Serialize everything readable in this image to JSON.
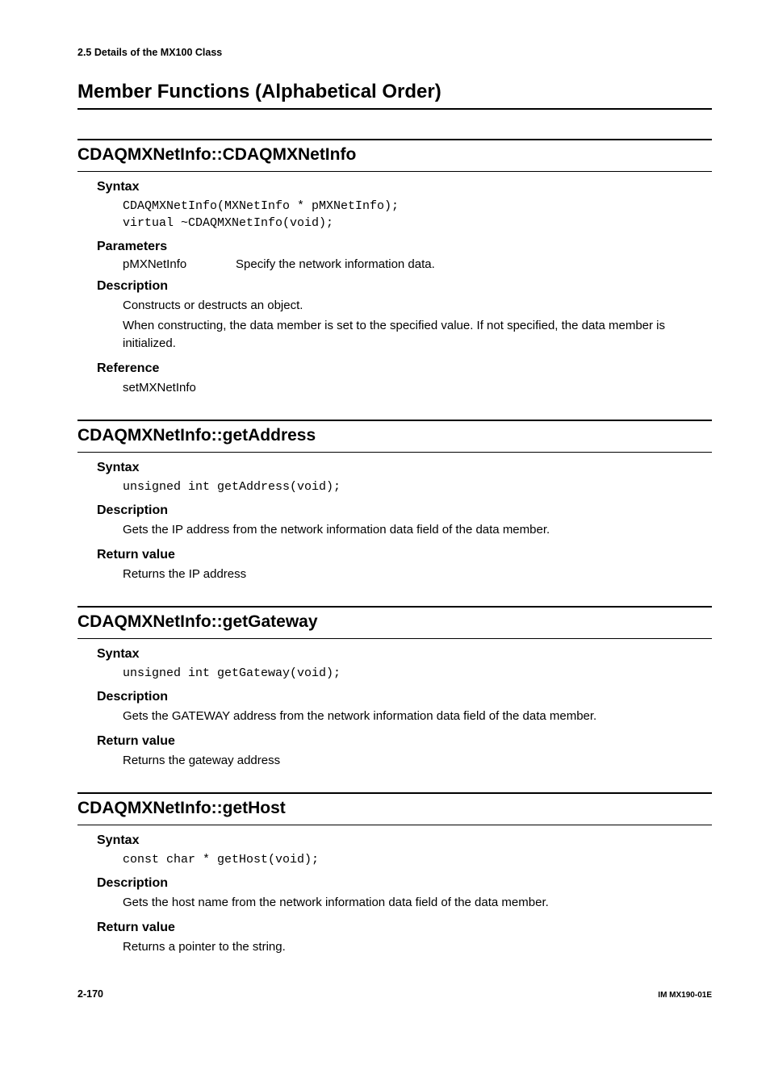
{
  "header": "2.5  Details of the MX100 Class",
  "title_main": "Member Functions (Alphabetical Order)",
  "sections": {
    "s1": {
      "heading": "CDAQMXNetInfo::CDAQMXNetInfo",
      "syntax_label": "Syntax",
      "syntax_code": "CDAQMXNetInfo(MXNetInfo * pMXNetInfo);\nvirtual ~CDAQMXNetInfo(void);",
      "params_label": "Parameters",
      "param_name": "pMXNetInfo",
      "param_desc": "Specify the network information data.",
      "desc_label": "Description",
      "desc_line1": "Constructs or destructs an object.",
      "desc_line2": "When constructing, the data member is set to the specified value. If not specified, the data member is initialized.",
      "ref_label": "Reference",
      "ref_text": "setMXNetInfo"
    },
    "s2": {
      "heading": "CDAQMXNetInfo::getAddress",
      "syntax_label": "Syntax",
      "syntax_code": "unsigned int getAddress(void);",
      "desc_label": "Description",
      "desc_text": "Gets the IP address from the network information data field of the data member.",
      "ret_label": "Return value",
      "ret_text": "Returns the IP address"
    },
    "s3": {
      "heading": "CDAQMXNetInfo::getGateway",
      "syntax_label": "Syntax",
      "syntax_code": "unsigned int getGateway(void);",
      "desc_label": "Description",
      "desc_text": "Gets the GATEWAY address from the network information data field of the data member.",
      "ret_label": "Return value",
      "ret_text": "Returns the gateway address"
    },
    "s4": {
      "heading": "CDAQMXNetInfo::getHost",
      "syntax_label": "Syntax",
      "syntax_code": "const char * getHost(void);",
      "desc_label": "Description",
      "desc_text": "Gets the host name from the network information data field of the data member.",
      "ret_label": "Return value",
      "ret_text": "Returns a pointer to the string."
    }
  },
  "footer": {
    "left": "2-170",
    "right": "IM MX190-01E"
  }
}
